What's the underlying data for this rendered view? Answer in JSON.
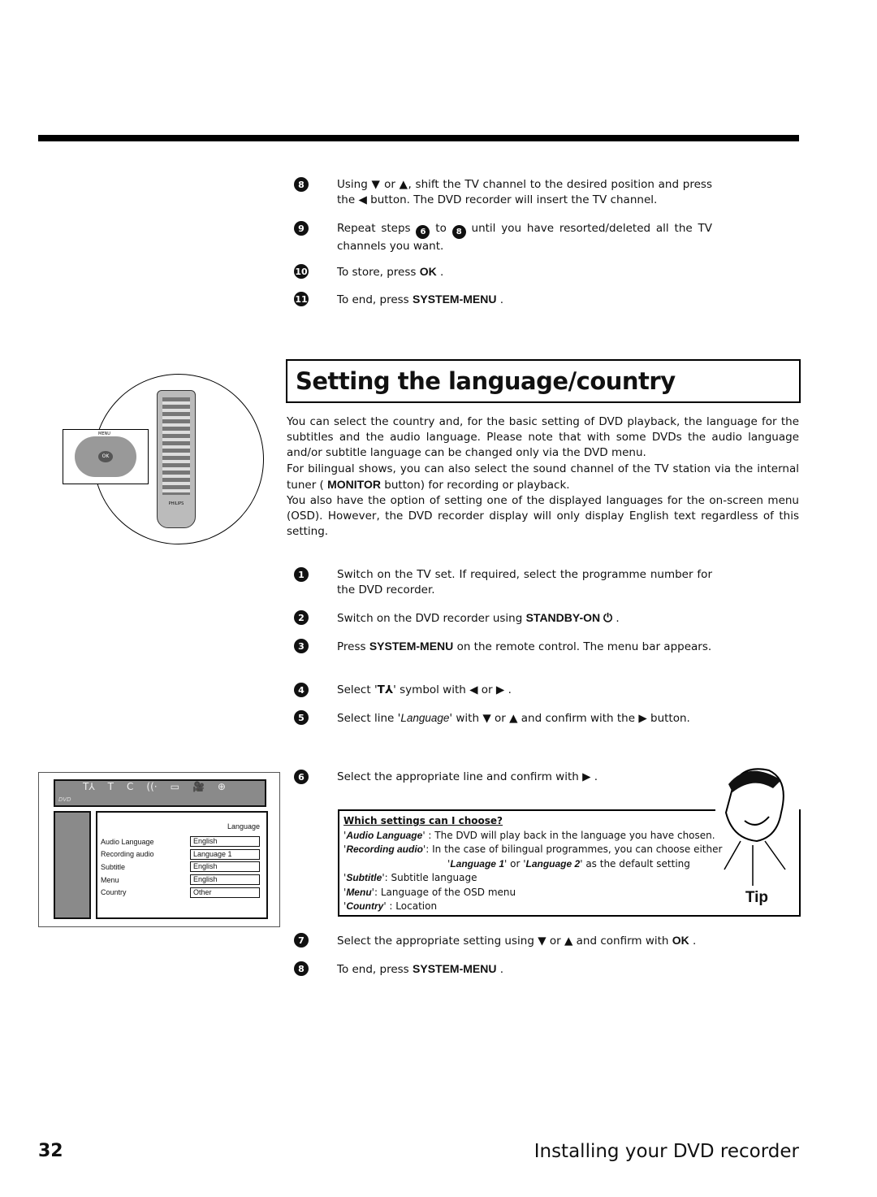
{
  "steps_top": [
    {
      "n": "8",
      "parts": [
        "Using ",
        "▼",
        " or ",
        "▲",
        ", shift the TV channel to the desired position and press the ",
        "◀",
        " button. The DVD recorder will insert the TV channel."
      ]
    },
    {
      "n": "9",
      "pre": "Repeat steps ",
      "a": "6",
      "mid": " to ",
      "b": "8",
      "post": " until you have resorted/deleted all the TV channels you want."
    },
    {
      "n": "10",
      "pre": "To store, press ",
      "kw": "OK",
      "post": " ."
    },
    {
      "n": "11",
      "pre": "To end, press ",
      "kw": "SYSTEM-MENU",
      "post": " ."
    }
  ],
  "section_title": "Setting the language/country",
  "body": [
    "You can select the country and, for the basic setting of DVD playback, the language for the subtitles and the audio language. Please note that with some DVDs the audio language and/or subtitle language can be changed only via the DVD menu.",
    {
      "pre": "For bilingual shows, you can also select the sound channel of the TV station via the internal tuner ( ",
      "kw": "MONITOR",
      "post": " button) for recording or playback."
    },
    "You also have the option of setting one of the displayed languages for the on-screen menu (OSD). However, the DVD recorder display will only display English text regardless of this setting."
  ],
  "steps": [
    {
      "n": "1",
      "text": "Switch on the TV set. If required, select the programme number for the DVD recorder."
    },
    {
      "n": "2",
      "pre": "Switch on the DVD recorder using ",
      "kw": "STANDBY-ON ⏻",
      "post": " ."
    },
    {
      "n": "3",
      "pre": "Press ",
      "kw": "SYSTEM-MENU",
      "post": " on the remote control. The menu bar appears."
    },
    {
      "n": "4",
      "pre": "Select '",
      "sym": "T⅄",
      "post": "' symbol with ◀ or ▶ ."
    },
    {
      "n": "5",
      "pre": "Select line '",
      "it": "Language",
      "post": "' with ▼ or ▲ and confirm with the ▶ button."
    },
    {
      "n": "6",
      "text": "Select the appropriate line and confirm with ▶ ."
    },
    {
      "n": "7",
      "pre": "Select the appropriate setting using ▼ or ▲ and confirm with ",
      "kw": "OK",
      "post": " ."
    },
    {
      "n": "8",
      "pre": "To end, press ",
      "kw": "SYSTEM-MENU",
      "post": " ."
    }
  ],
  "osd": {
    "top_icons": [
      "T⅄",
      "T",
      "C",
      "((·",
      "▭",
      "🎥",
      "⊕"
    ],
    "header": "Language",
    "rows": [
      {
        "label": "Audio Language",
        "value": "English"
      },
      {
        "label": "Recording audio",
        "value": "Language 1"
      },
      {
        "label": "Subtitle",
        "value": "English"
      },
      {
        "label": "Menu",
        "value": "English"
      },
      {
        "label": "Country",
        "value": "Other"
      }
    ],
    "logo": "DVD"
  },
  "tip": {
    "heading": "Which settings can I choose?",
    "items": [
      {
        "k": "Audio Language",
        "sep": "' : ",
        "v": "The DVD will play back in the language you have chosen."
      },
      {
        "k": "Recording audio",
        "sep": "': ",
        "v": "In the case of bilingual programmes, you can choose either"
      },
      {
        "k": "Subtitle",
        "sep": "': ",
        "v": "Subtitle language"
      },
      {
        "k": "Menu",
        "sep": "': ",
        "v": "Language of the OSD menu"
      },
      {
        "k": "Country",
        "sep": "' : ",
        "v": "Location"
      }
    ],
    "cont_a": "Language 1",
    "cont_or": "' or '",
    "cont_b": "Language 2",
    "cont_post": "' as the default setting",
    "label": "Tip"
  },
  "remote_brand": "PHILIPS",
  "remote_labels": {
    "menu": "MENU",
    "ok": "OK"
  },
  "footer": {
    "page": "32",
    "title": "Installing your DVD recorder"
  }
}
